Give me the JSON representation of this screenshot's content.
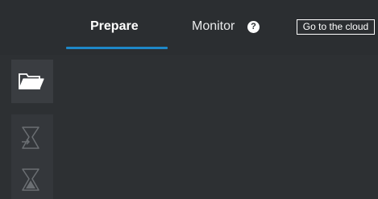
{
  "tabs": {
    "prepare_label": "Prepare",
    "monitor_label": "Monitor",
    "help_glyph": "?"
  },
  "header": {
    "cloud_button_label": "Go to the cloud"
  },
  "sidebar": {
    "items": [
      {
        "icon": "folder-open-icon",
        "enabled": true
      },
      {
        "icon": "funnel-import-icon",
        "enabled": false
      },
      {
        "icon": "funnel-filled-icon",
        "enabled": false
      }
    ]
  },
  "colors": {
    "background": "#2d3033",
    "accent": "#1e88c8",
    "sidebar_button": "#3a3d41",
    "icon_disabled": "#6b6f73"
  }
}
